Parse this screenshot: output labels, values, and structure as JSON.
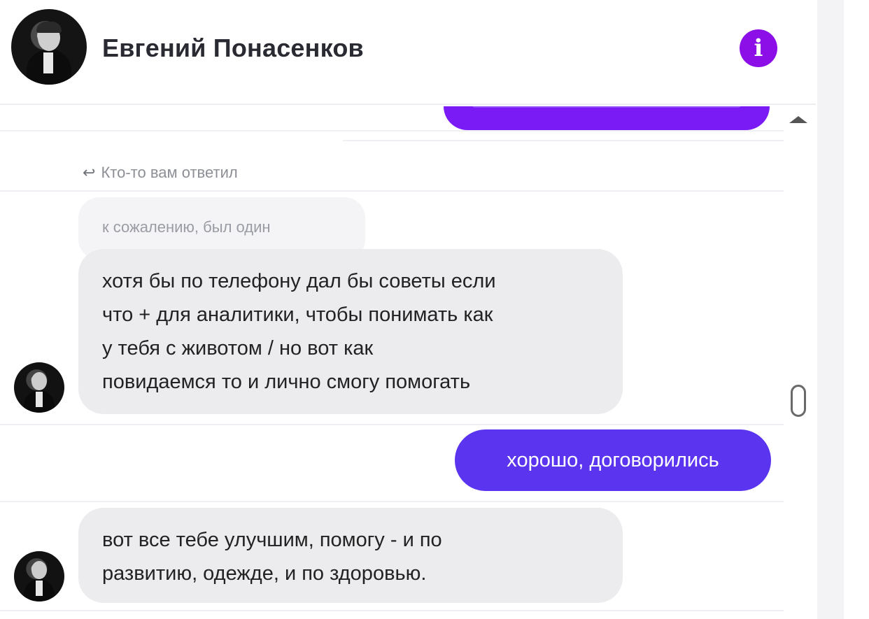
{
  "header": {
    "contact_name": "Евгений Понасенков",
    "info_icon": "info-icon",
    "accent_color": "#8c0fe8"
  },
  "reply_note": {
    "icon": "reply-arrow-icon",
    "text": "Кто-то вам ответил"
  },
  "quoted_message": {
    "text": "к сожалению, был один"
  },
  "messages": [
    {
      "direction": "incoming",
      "lines": [
        "хотя бы по телефону дал бы советы если",
        "что + для аналитики, чтобы понимать как",
        "у тебя с животом / но вот как",
        "повидаемся то и лично смогу помогать"
      ]
    },
    {
      "direction": "outgoing",
      "text": "хорошо, договорились",
      "color": "#5b34f0"
    },
    {
      "direction": "incoming",
      "lines": [
        "вот все тебе улучшим, помогу - и по",
        "развитию, одежде, и по здоровью."
      ]
    }
  ],
  "colors": {
    "incoming_bubble": "#ececef",
    "outgoing_bubble_top": "#7a1bf6"
  }
}
